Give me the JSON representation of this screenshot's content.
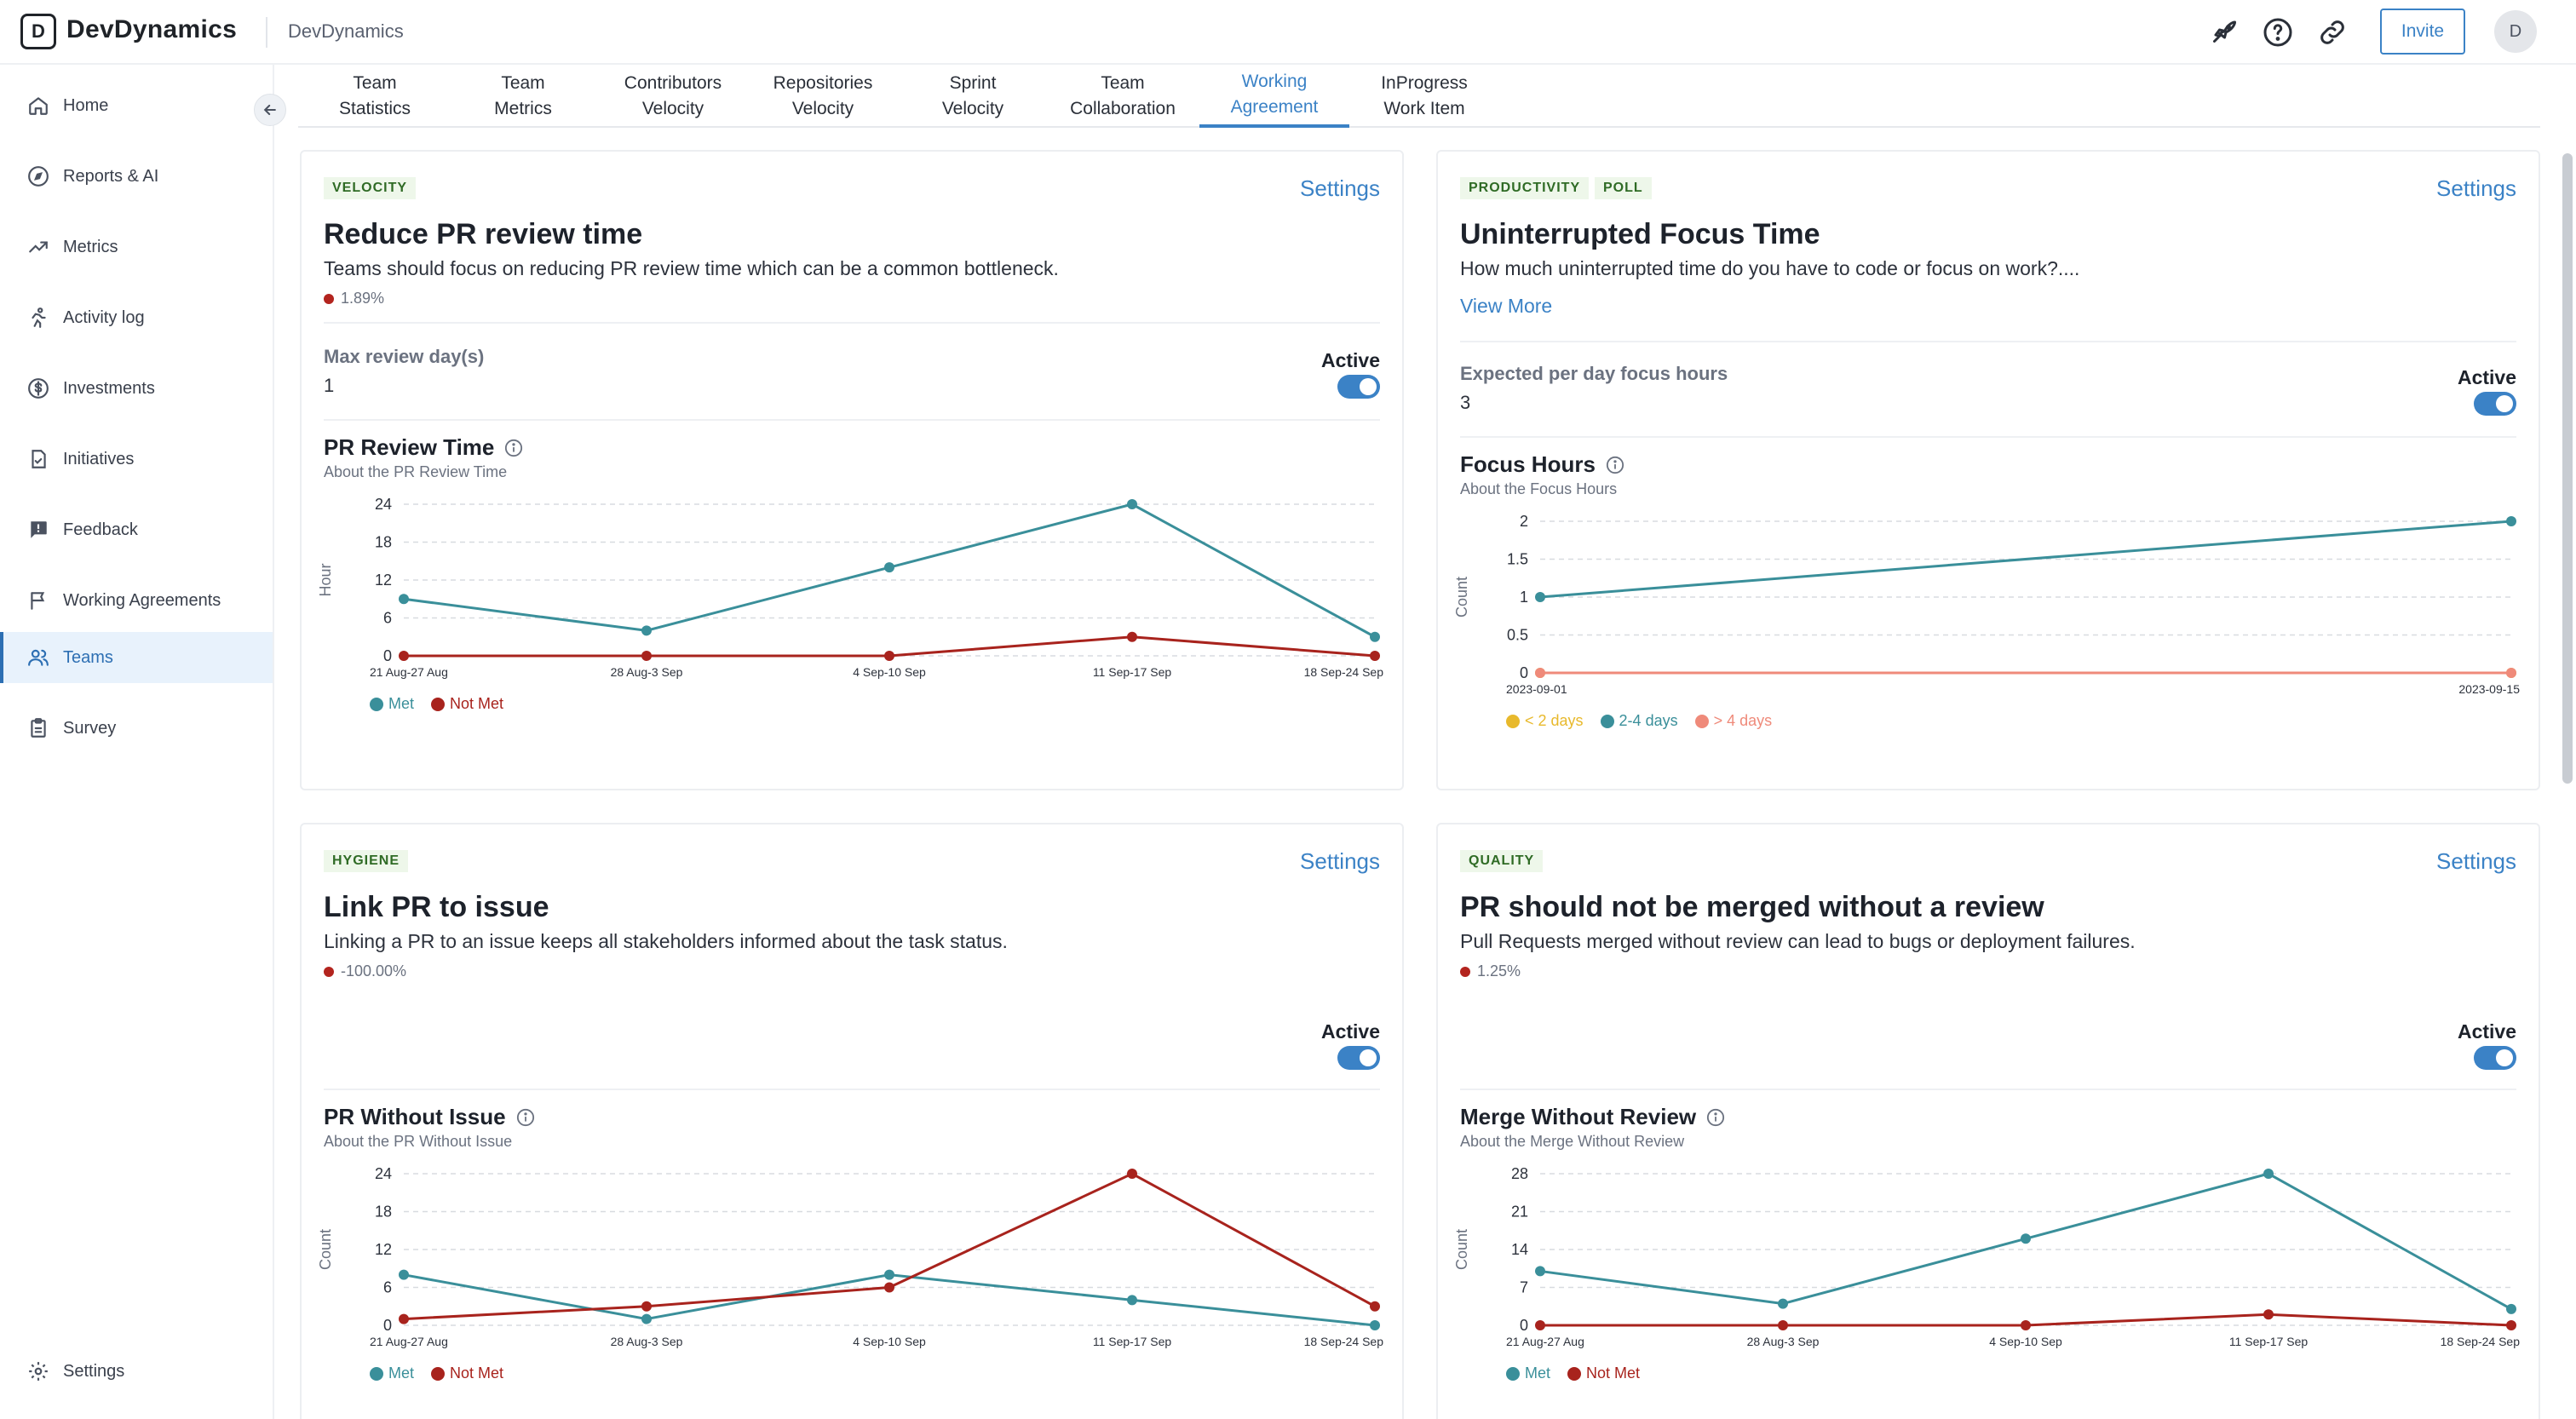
{
  "header": {
    "logo_letter": "D",
    "brand": "DevDynamics",
    "org": "DevDynamics",
    "invite_label": "Invite",
    "avatar_letter": "D"
  },
  "sidebar": {
    "items": [
      {
        "label": "Home",
        "icon": "home-icon"
      },
      {
        "label": "Reports & AI",
        "icon": "compass-icon"
      },
      {
        "label": "Metrics",
        "icon": "trend-icon"
      },
      {
        "label": "Activity log",
        "icon": "run-icon"
      },
      {
        "label": "Investments",
        "icon": "dollar-icon"
      },
      {
        "label": "Initiatives",
        "icon": "doc-check-icon"
      },
      {
        "label": "Feedback",
        "icon": "feedback-icon"
      },
      {
        "label": "Working Agreements",
        "icon": "flag-icon"
      },
      {
        "label": "Teams",
        "icon": "users-icon",
        "active": true
      },
      {
        "label": "Survey",
        "icon": "clipboard-icon"
      }
    ],
    "settings_label": "Settings"
  },
  "tabs": [
    {
      "line1": "Team",
      "line2": "Statistics"
    },
    {
      "line1": "Team",
      "line2": "Metrics"
    },
    {
      "line1": "Contributors",
      "line2": "Velocity"
    },
    {
      "line1": "Repositories",
      "line2": "Velocity"
    },
    {
      "line1": "Sprint",
      "line2": "Velocity"
    },
    {
      "line1": "Team",
      "line2": "Collaboration"
    },
    {
      "line1": "Working",
      "line2": "Agreement",
      "active": true
    },
    {
      "line1": "InProgress",
      "line2": "Work Item"
    }
  ],
  "cards": [
    {
      "tags": [
        "VELOCITY"
      ],
      "settings": "Settings",
      "title": "Reduce PR review time",
      "description": "Teams should focus on reducing PR review time which can be a common bottleneck.",
      "change": "1.89%",
      "rule_label": "Max review day(s)",
      "rule_value": "1",
      "active_label": "Active",
      "chart_title": "PR Review Time",
      "chart_sub": "About the PR Review Time"
    },
    {
      "tags": [
        "PRODUCTIVITY",
        "POLL"
      ],
      "settings": "Settings",
      "title": "Uninterrupted Focus Time",
      "description": "How much uninterrupted time do you have to code or focus on work?....",
      "view_more": "View More",
      "rule_label": "Expected per day focus hours",
      "rule_value": "3",
      "active_label": "Active",
      "chart_title": "Focus Hours",
      "chart_sub": "About the Focus Hours"
    },
    {
      "tags": [
        "HYGIENE"
      ],
      "settings": "Settings",
      "title": "Link PR to issue",
      "description": "Linking a PR to an issue keeps all stakeholders informed about the task status.",
      "change": "-100.00%",
      "active_label": "Active",
      "chart_title": "PR Without Issue",
      "chart_sub": "About the PR Without Issue"
    },
    {
      "tags": [
        "QUALITY"
      ],
      "settings": "Settings",
      "title": "PR should not be merged without a review",
      "description": "Pull Requests merged without review can lead to bugs or deployment failures.",
      "change": "1.25%",
      "active_label": "Active",
      "chart_title": "Merge Without Review",
      "chart_sub": "About the Merge Without Review"
    }
  ],
  "colors": {
    "met": "#3a8f9a",
    "not_met": "#a8231d",
    "lt2": "#e8b92c",
    "mid": "#3a8f9a",
    "gt4": "#ef8a7a",
    "accent": "#3b82c6"
  },
  "chart_data": [
    {
      "type": "line",
      "title": "PR Review Time",
      "ylabel": "Hour",
      "categories": [
        "21 Aug-27 Aug",
        "28 Aug-3 Sep",
        "4 Sep-10 Sep",
        "11 Sep-17 Sep",
        "18 Sep-24 Sep"
      ],
      "yticks": [
        0,
        6,
        12,
        18,
        24
      ],
      "ylim": [
        0,
        24
      ],
      "series": [
        {
          "name": "Met",
          "values": [
            9,
            4,
            14,
            24,
            3
          ]
        },
        {
          "name": "Not Met",
          "values": [
            0,
            0,
            0,
            3,
            0
          ]
        }
      ]
    },
    {
      "type": "line",
      "title": "Focus Hours",
      "ylabel": "Count",
      "categories": [
        "2023-09-01",
        "2023-09-15"
      ],
      "yticks": [
        0,
        0.5,
        1,
        1.5,
        2
      ],
      "ylim": [
        0,
        2
      ],
      "series": [
        {
          "name": "< 2 days",
          "values": [
            0,
            0
          ]
        },
        {
          "name": "2-4 days",
          "values": [
            1,
            2
          ]
        },
        {
          "name": "> 4 days",
          "values": [
            0,
            0
          ]
        }
      ]
    },
    {
      "type": "line",
      "title": "PR Without Issue",
      "ylabel": "Count",
      "categories": [
        "21 Aug-27 Aug",
        "28 Aug-3 Sep",
        "4 Sep-10 Sep",
        "11 Sep-17 Sep",
        "18 Sep-24 Sep"
      ],
      "yticks": [
        0,
        6,
        12,
        18,
        24
      ],
      "ylim": [
        0,
        24
      ],
      "series": [
        {
          "name": "Met",
          "values": [
            8,
            1,
            8,
            4,
            0
          ]
        },
        {
          "name": "Not Met",
          "values": [
            1,
            3,
            6,
            24,
            3
          ]
        }
      ]
    },
    {
      "type": "line",
      "title": "Merge Without Review",
      "ylabel": "Count",
      "categories": [
        "21 Aug-27 Aug",
        "28 Aug-3 Sep",
        "4 Sep-10 Sep",
        "11 Sep-17 Sep",
        "18 Sep-24 Sep"
      ],
      "yticks": [
        0,
        7,
        14,
        21,
        28
      ],
      "ylim": [
        0,
        28
      ],
      "series": [
        {
          "name": "Met",
          "values": [
            10,
            4,
            16,
            28,
            3
          ]
        },
        {
          "name": "Not Met",
          "values": [
            0,
            0,
            0,
            2,
            0
          ]
        }
      ]
    }
  ]
}
